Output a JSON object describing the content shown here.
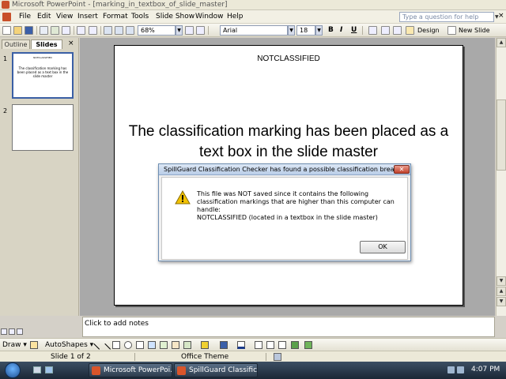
{
  "window": {
    "title": "Microsoft PowerPoint - [marking_in_textbox_of_slide_master]"
  },
  "menu": {
    "items": [
      "File",
      "Edit",
      "View",
      "Insert",
      "Format",
      "Tools",
      "Slide Show",
      "Window",
      "Help"
    ],
    "help_placeholder": "Type a question for help",
    "close_glyph": "×"
  },
  "toolbar": {
    "zoom": "68%",
    "font": "Arial",
    "font_size": "18",
    "bold": "B",
    "italic": "I",
    "underline": "U",
    "design_label": "Design",
    "new_slide_label": "New Slide"
  },
  "pane": {
    "tab_outline": "Outline",
    "tab_slides": "Slides",
    "close_glyph": "×",
    "thumbnails": [
      {
        "number": "1",
        "heading": "NOTCLASSIFIED",
        "body": "The classification marking has been placed as a text box in the slide master"
      },
      {
        "number": "2",
        "heading": "",
        "body": ""
      }
    ]
  },
  "slide": {
    "marking": "NOTCLASSIFIED",
    "body": "The classification marking has been placed as a text box in the slide master"
  },
  "notes": {
    "placeholder": "Click to add notes"
  },
  "drawing": {
    "draw_label": "Draw ▾",
    "autoshapes_label": "AutoShapes ▾"
  },
  "status": {
    "slide_info": "Slide 1 of 2",
    "theme": "Office Theme"
  },
  "taskbar": {
    "buttons": [
      "Microsoft PowerPoi...",
      "SpillGuard Classifica..."
    ],
    "clock": "4:07 PM"
  },
  "dialog": {
    "title": "SpillGuard Classification Checker has found a possible classification breach",
    "message": "This file was NOT saved since it contains the following classification markings that are higher than this computer can handle:",
    "detail": "NOTCLASSIFIED (located in a textbox in the slide master)",
    "ok_label": "OK",
    "close_glyph": "✕"
  },
  "colors": {
    "slide_area_bg": "#a9a9a9",
    "selected_thumb_border": "#3a5fa5",
    "dialog_close": "#c2412b",
    "warning": "#f2c200"
  }
}
